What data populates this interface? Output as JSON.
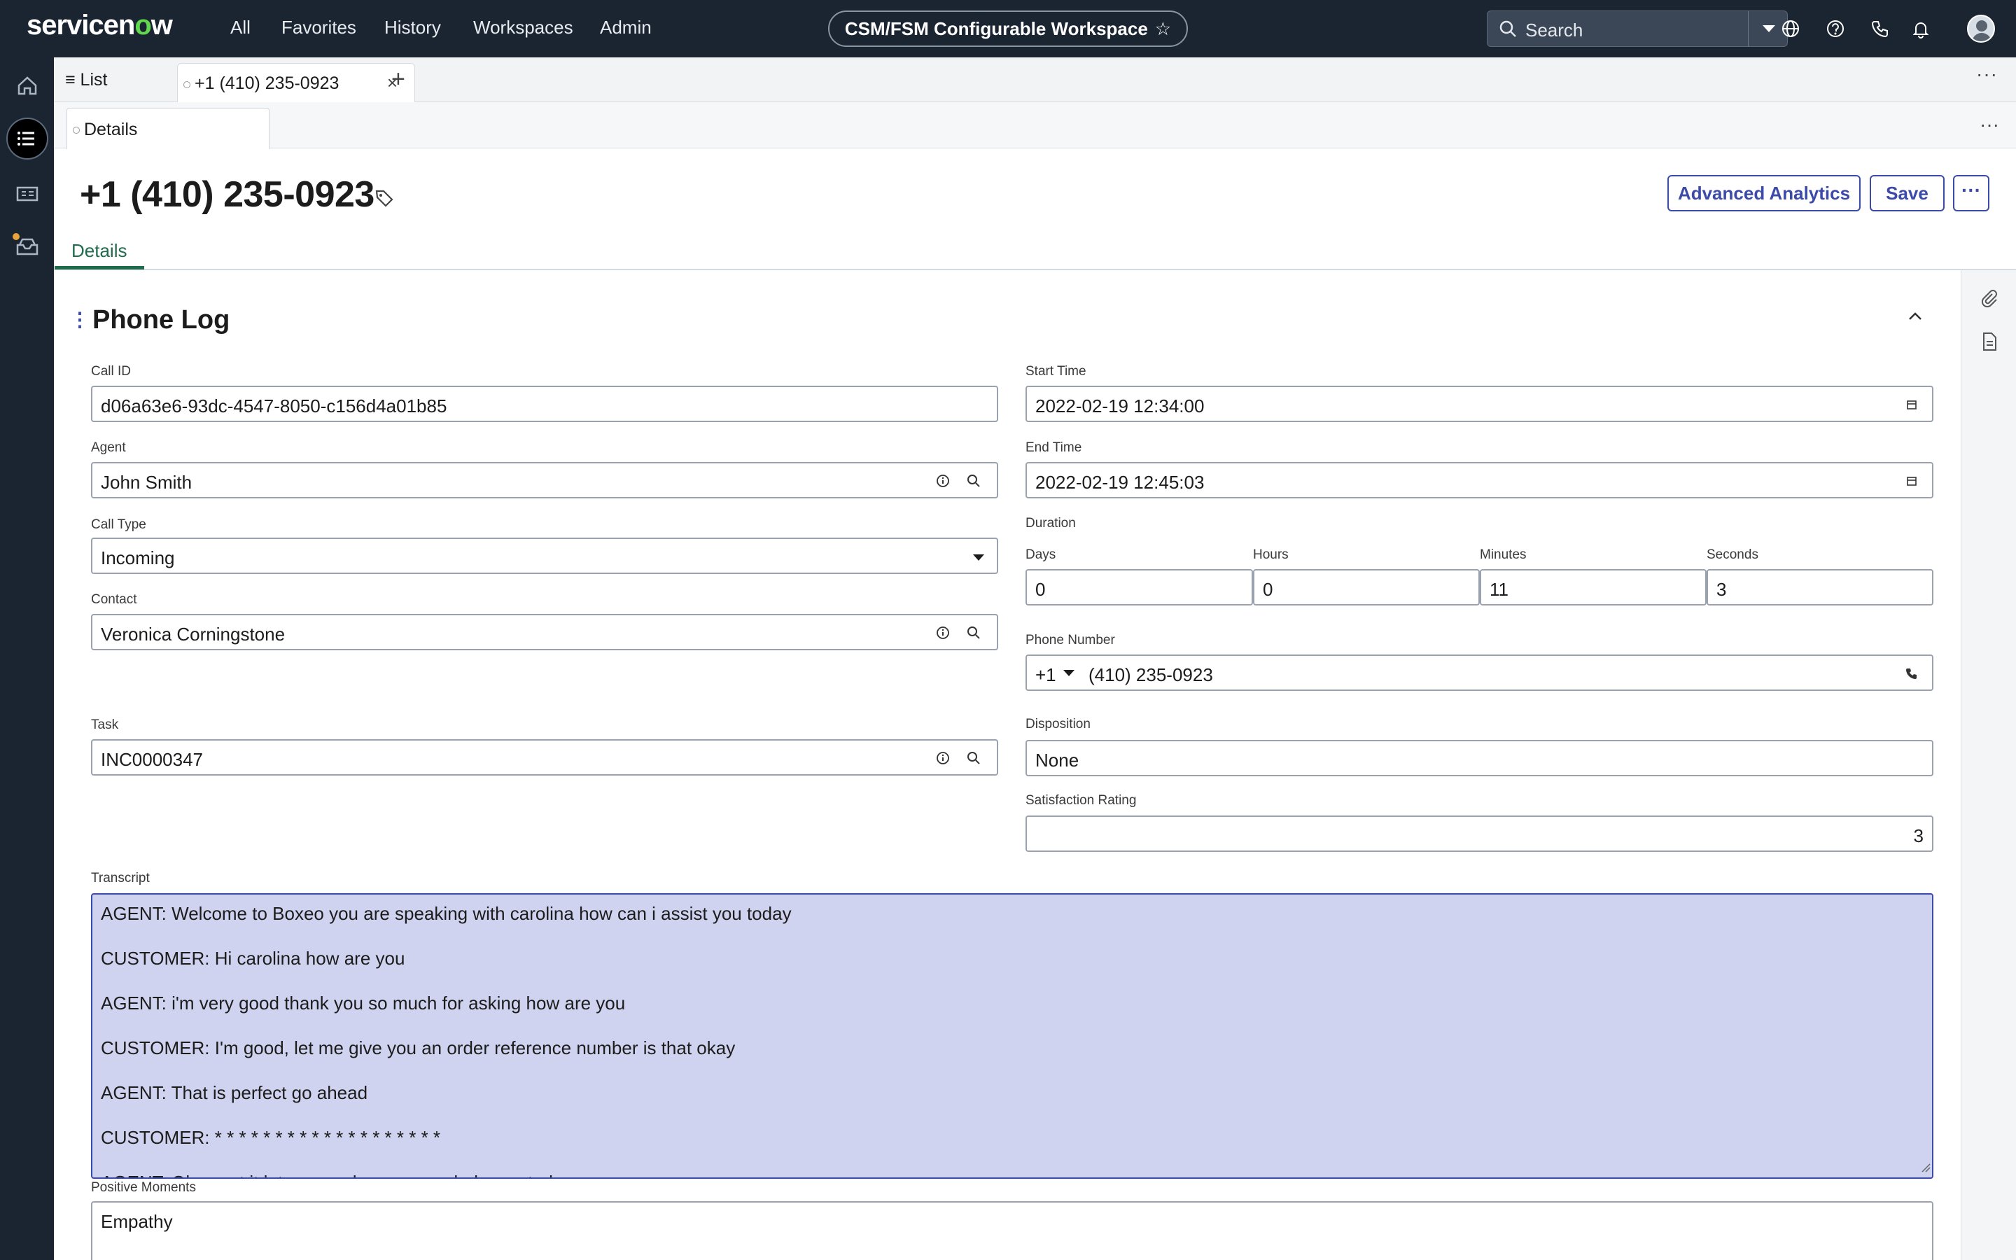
{
  "topbar": {
    "logo_pre": "servicen",
    "logo_o": "o",
    "logo_post": "w",
    "nav": [
      "All",
      "Favorites",
      "History",
      "Workspaces",
      "Admin"
    ],
    "workspace_label": "CSM/FSM Configurable Workspace",
    "workspace_star": "☆",
    "search_placeholder": "Search"
  },
  "tabs": {
    "list_label": "List",
    "record_tab_label": "+1 (410) 235-0923",
    "close": "×",
    "add": "+",
    "more": "···"
  },
  "subtabs": {
    "details_label": "Details",
    "more": "···"
  },
  "record": {
    "title": "+1 (410) 235-0923",
    "buttons": {
      "advanced_analytics": "Advanced Analytics",
      "save": "Save",
      "more": "···"
    },
    "tab_details": "Details"
  },
  "section": {
    "title": "Phone Log",
    "drag": "⋮"
  },
  "form": {
    "call_id": {
      "label": "Call ID",
      "value": "d06a63e6-93dc-4547-8050-c156d4a01b85"
    },
    "agent": {
      "label": "Agent",
      "value": "John Smith"
    },
    "call_type": {
      "label": "Call Type",
      "value": "Incoming"
    },
    "contact": {
      "label": "Contact",
      "value": "Veronica Corningstone"
    },
    "task": {
      "label": "Task",
      "value": "INC0000347"
    },
    "start_time": {
      "label": "Start Time",
      "value": "2022-02-19 12:34:00"
    },
    "end_time": {
      "label": "End Time",
      "value": "2022-02-19 12:45:03"
    },
    "duration": {
      "label": "Duration",
      "days": {
        "label": "Days",
        "value": "0"
      },
      "hours": {
        "label": "Hours",
        "value": "0"
      },
      "minutes": {
        "label": "Minutes",
        "value": "11"
      },
      "seconds": {
        "label": "Seconds",
        "value": "3"
      }
    },
    "phone_number": {
      "label": "Phone Number",
      "country_code": "+1",
      "value": "(410) 235-0923"
    },
    "disposition": {
      "label": "Disposition",
      "value": "None"
    },
    "satisfaction": {
      "label": "Satisfaction Rating",
      "value": "3"
    },
    "transcript": {
      "label": "Transcript",
      "lines": [
        "AGENT: Welcome to Boxeo you are speaking with carolina how can i assist you today",
        "CUSTOMER: Hi carolina how are you",
        "AGENT: i'm very good thank you so much for asking how are you",
        "CUSTOMER: I'm good, let me give you an order reference number is that okay",
        "AGENT: That is perfect go ahead",
        "CUSTOMER: * * * * * * * * * * * * * * * * * * *",
        "AGENT: Okay got it let me see how we can help you today"
      ]
    },
    "positive_moments": {
      "label": "Positive Moments",
      "value": "Empathy"
    }
  },
  "colors": {
    "topbar_bg": "#1b2532",
    "accent": "#3c4aa8",
    "tab_active": "#1e6b4e",
    "transcript_bg": "#cfd3ef"
  }
}
